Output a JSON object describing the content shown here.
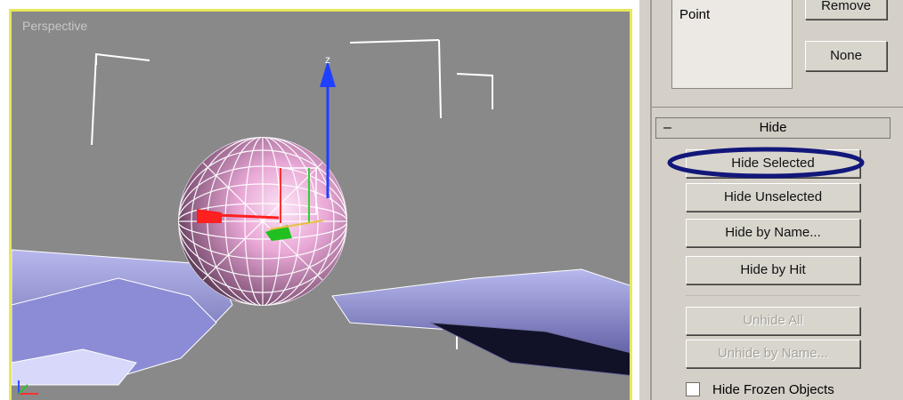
{
  "viewport": {
    "label": "Perspective",
    "gizmo_axis_label": "z"
  },
  "panel": {
    "selection_list": {
      "items": [
        "Point"
      ]
    },
    "remove_label": "Remove",
    "none_label": "None",
    "hide_rollout": {
      "collapse_symbol": "–",
      "title": "Hide",
      "buttons": [
        {
          "label": "Hide Selected",
          "enabled": true,
          "highlighted": true
        },
        {
          "label": "Hide Unselected",
          "enabled": true
        },
        {
          "label": "Hide by Name...",
          "enabled": true
        },
        {
          "label": "Hide by Hit",
          "enabled": true
        },
        {
          "label": "Unhide All",
          "enabled": false
        },
        {
          "label": "Unhide by Name...",
          "enabled": false
        }
      ],
      "checkbox": {
        "label": "Hide Frozen Objects",
        "checked": false
      }
    }
  },
  "colors": {
    "viewport_border": "#e8e85a",
    "viewport_bg": "#898989",
    "highlight_circle": "#12177a",
    "sphere": "#e9a8d6",
    "mesh": "#9b9bd9"
  }
}
